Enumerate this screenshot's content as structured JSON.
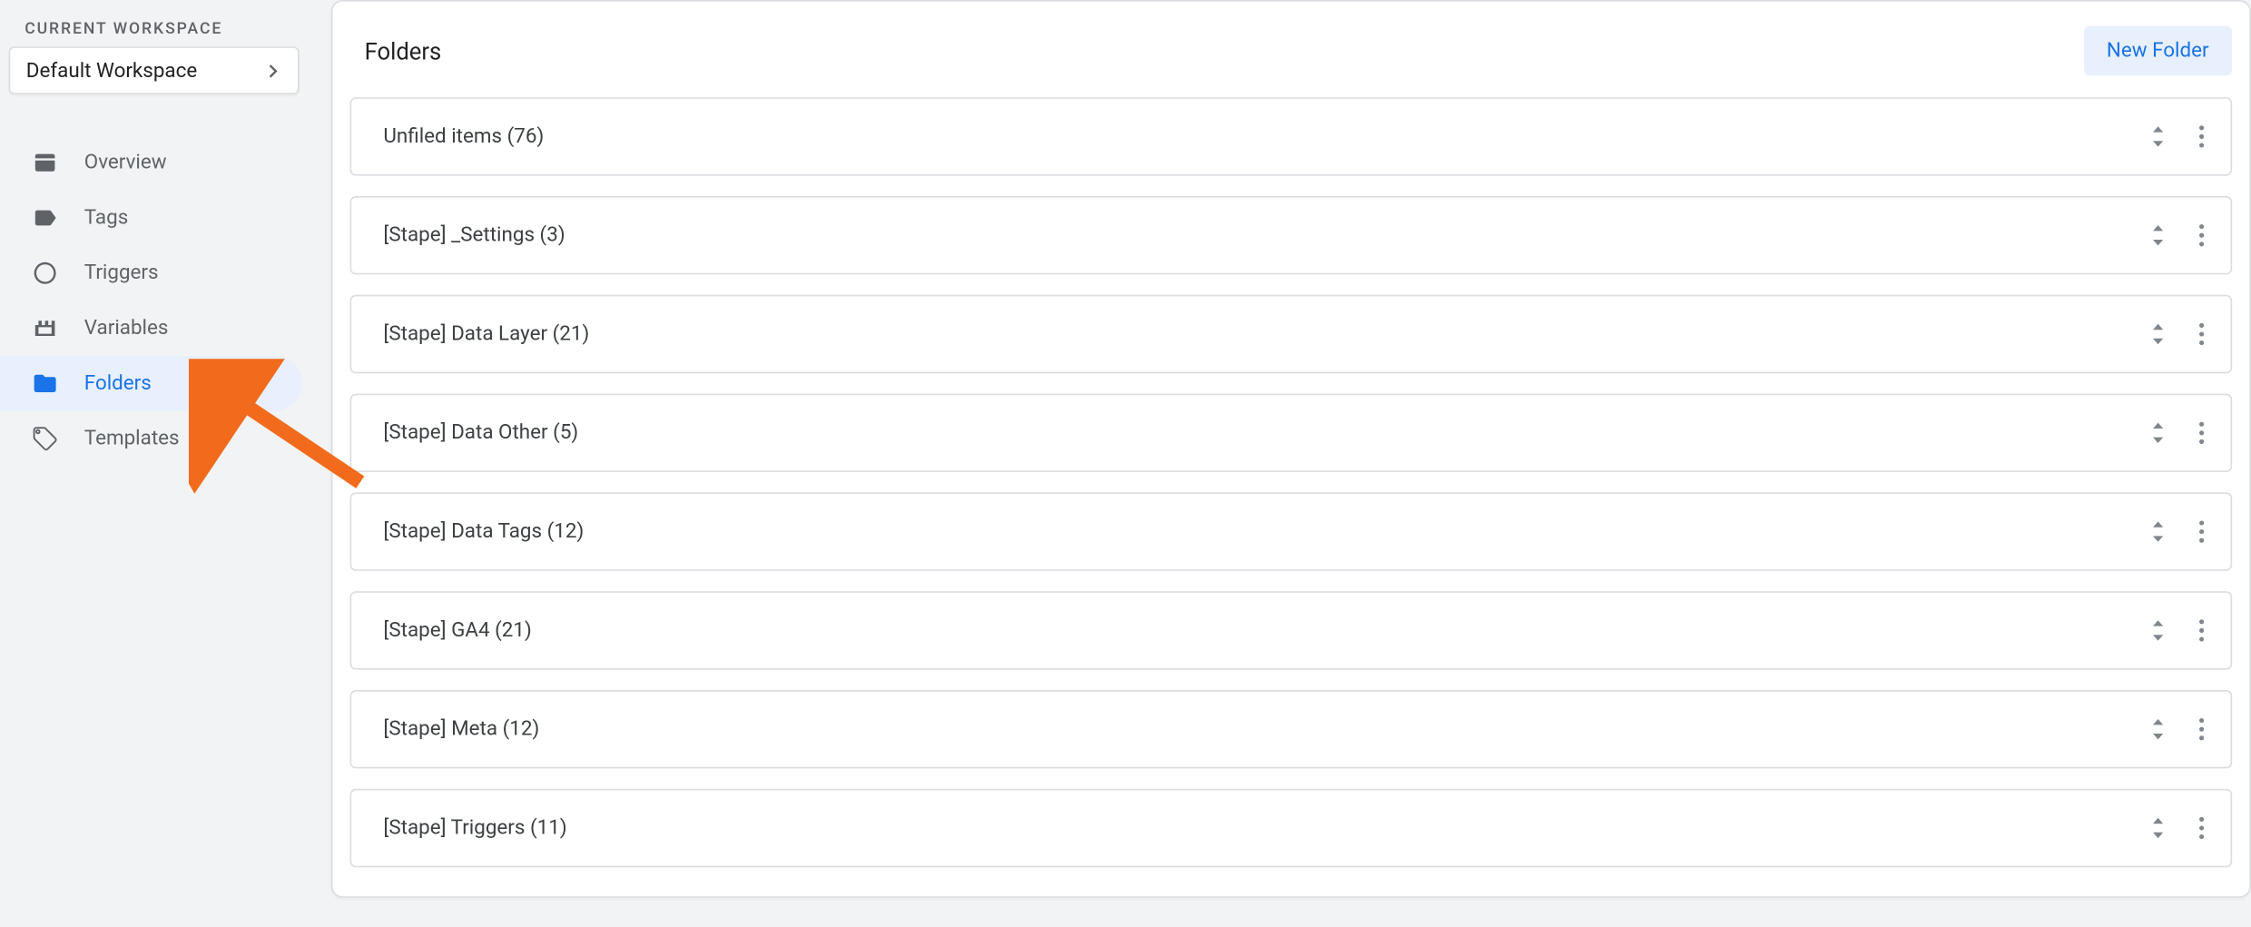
{
  "sidebar": {
    "workspace_label": "CURRENT WORKSPACE",
    "workspace_name": "Default Workspace",
    "items": [
      {
        "label": "Overview"
      },
      {
        "label": "Tags"
      },
      {
        "label": "Triggers"
      },
      {
        "label": "Variables"
      },
      {
        "label": "Folders"
      },
      {
        "label": "Templates"
      }
    ],
    "active_index": 4
  },
  "main": {
    "title": "Folders",
    "new_button": "New Folder",
    "folders": [
      {
        "label": "Unfiled items (76)"
      },
      {
        "label": "[Stape] _Settings (3)"
      },
      {
        "label": "[Stape] Data Layer (21)"
      },
      {
        "label": "[Stape] Data Other (5)"
      },
      {
        "label": "[Stape] Data Tags (12)"
      },
      {
        "label": "[Stape] GA4 (21)"
      },
      {
        "label": "[Stape] Meta (12)"
      },
      {
        "label": "[Stape] Triggers (11)"
      }
    ]
  }
}
